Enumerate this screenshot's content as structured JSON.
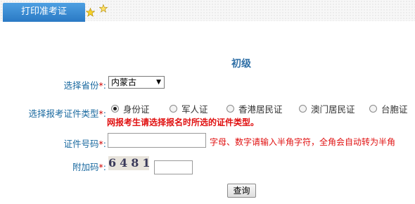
{
  "header": {
    "tab_label": "打印准考证"
  },
  "form": {
    "level": "初级",
    "province_label": "选择省份",
    "province_value": "内蒙古",
    "id_type_label": "选择报考证件类型",
    "id_types": [
      "身份证",
      "军人证",
      "香港居民证",
      "澳门居民证",
      "台胞证"
    ],
    "id_type_warning": "网报考生请选择报名时所选的证件类型。",
    "id_number_label": "证件号码",
    "id_number_value": "",
    "id_number_hint": "字母、数字请输入半角字符，全角会自动转为半角",
    "captcha_label": "附加码",
    "captcha_text": "6481",
    "captcha_value": "",
    "submit_label": "查询",
    "required_mark": "*",
    "colon": ":"
  },
  "colors": {
    "tab": "#3a8fd6",
    "label": "#1b6aa0",
    "warning": "#e01010"
  },
  "icons": [
    "star-icon",
    "star-icon"
  ]
}
